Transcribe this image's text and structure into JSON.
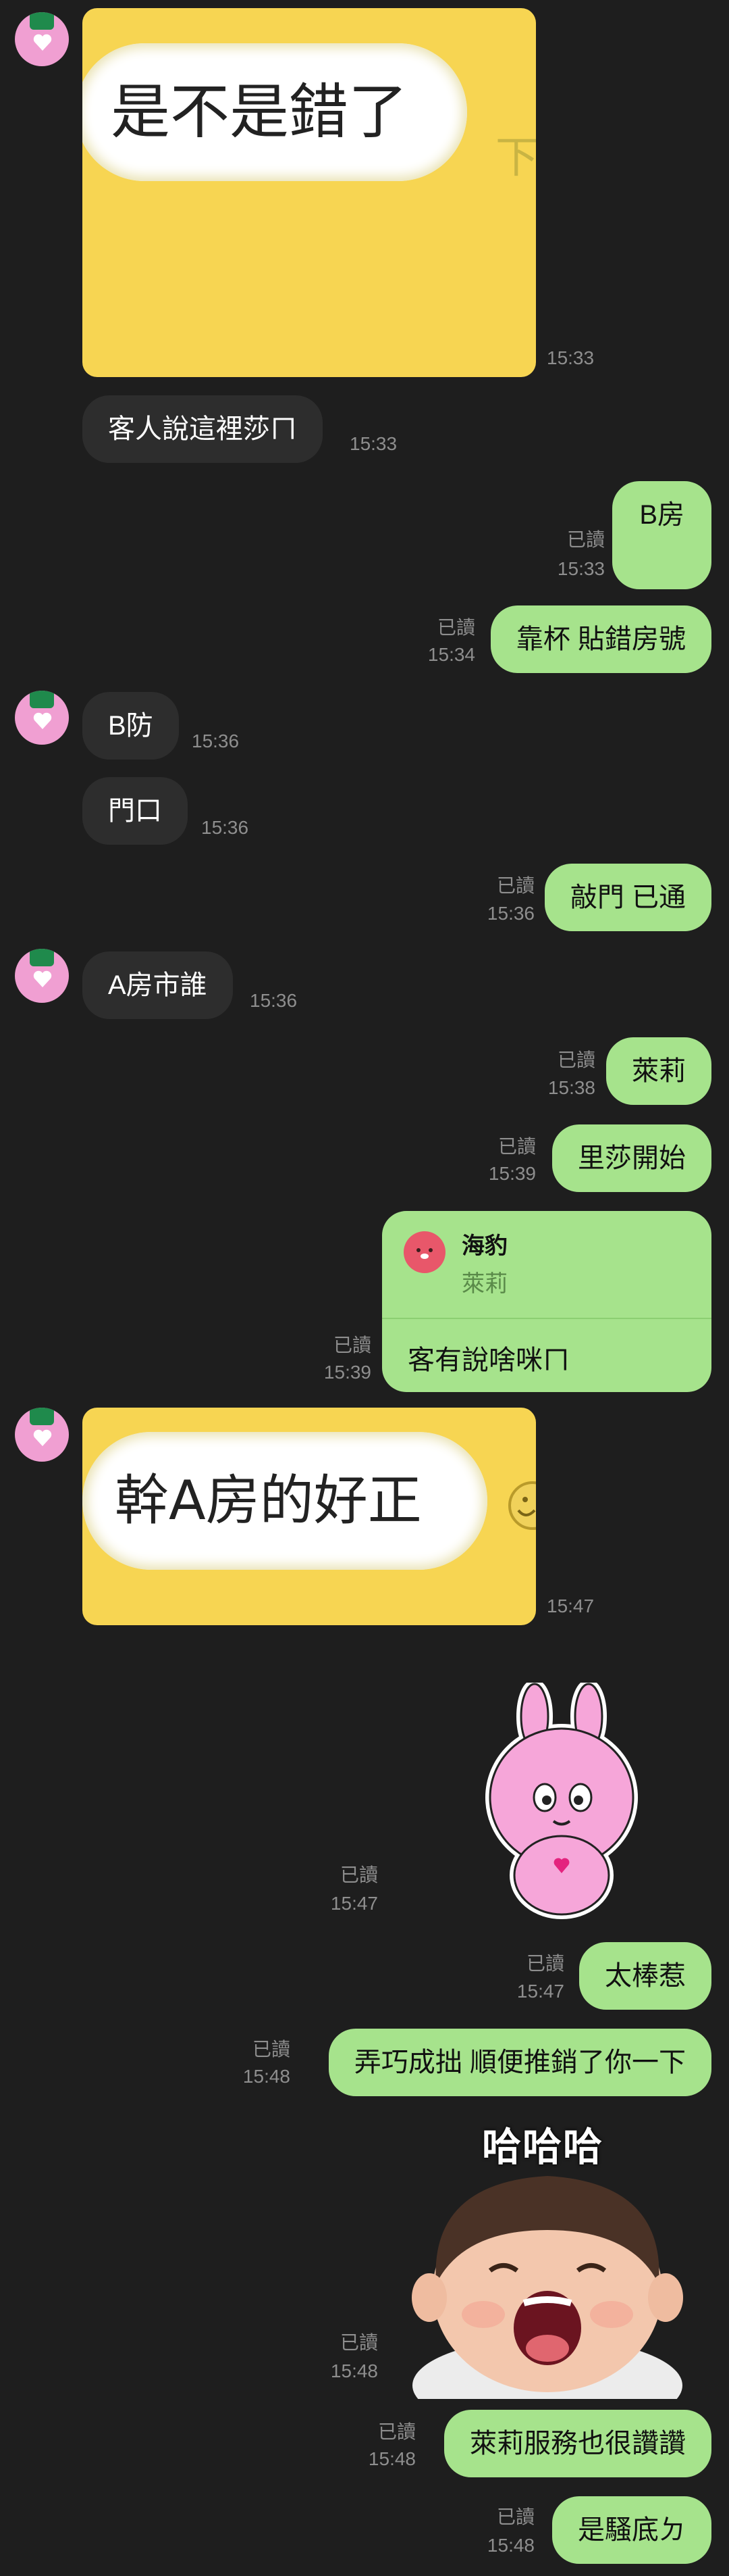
{
  "messages": {
    "m1": {
      "text": "是不是錯了",
      "ghost": "下",
      "time": "15:33"
    },
    "m2": {
      "text": "客人說這裡莎ㄇ",
      "time": "15:33"
    },
    "m3": {
      "text": "B房",
      "read": "已讀",
      "time": "15:33"
    },
    "m4": {
      "text": "靠杯 貼錯房號",
      "read": "已讀",
      "time": "15:34"
    },
    "m5": {
      "text": "B防",
      "time": "15:36"
    },
    "m6": {
      "text": "門口",
      "time": "15:36"
    },
    "m7": {
      "text": "敲門 已通",
      "read": "已讀",
      "time": "15:36"
    },
    "m8": {
      "text": "A房市誰",
      "time": "15:36"
    },
    "m9": {
      "text": "萊莉",
      "read": "已讀",
      "time": "15:38"
    },
    "m10": {
      "text": "里莎開始",
      "read": "已讀",
      "time": "15:39"
    },
    "m11": {
      "reply_name": "海豹",
      "reply_quote": "萊莉",
      "text": "客有說啥咪ㄇ",
      "read": "已讀",
      "time": "15:39"
    },
    "m12": {
      "text": "幹A房的好正",
      "time": "15:47"
    },
    "m13": {
      "read": "已讀",
      "time": "15:47"
    },
    "m14": {
      "text": "太棒惹",
      "read": "已讀",
      "time": "15:47"
    },
    "m15": {
      "text": "弄巧成拙 順便推銷了你一下",
      "read": "已讀",
      "time": "15:48"
    },
    "m16": {
      "sticker_text": "哈哈哈",
      "read": "已讀",
      "time": "15:48"
    },
    "m17": {
      "text": "萊莉服務也很讚讚",
      "read": "已讀",
      "time": "15:48"
    },
    "m18": {
      "text": "是騷底ㄉ",
      "read": "已讀",
      "time": "15:48"
    }
  },
  "colors": {
    "background": "#1e1e1e",
    "incoming": "#2d2d2d",
    "outgoing": "#a6e38c",
    "image_card": "#f7d552"
  },
  "icons": {
    "avatar": "avatar-icon",
    "sticker_rabbit": "pink-rabbit-sticker",
    "sticker_baby": "laughing-baby-sticker",
    "seal": "seal-icon"
  }
}
